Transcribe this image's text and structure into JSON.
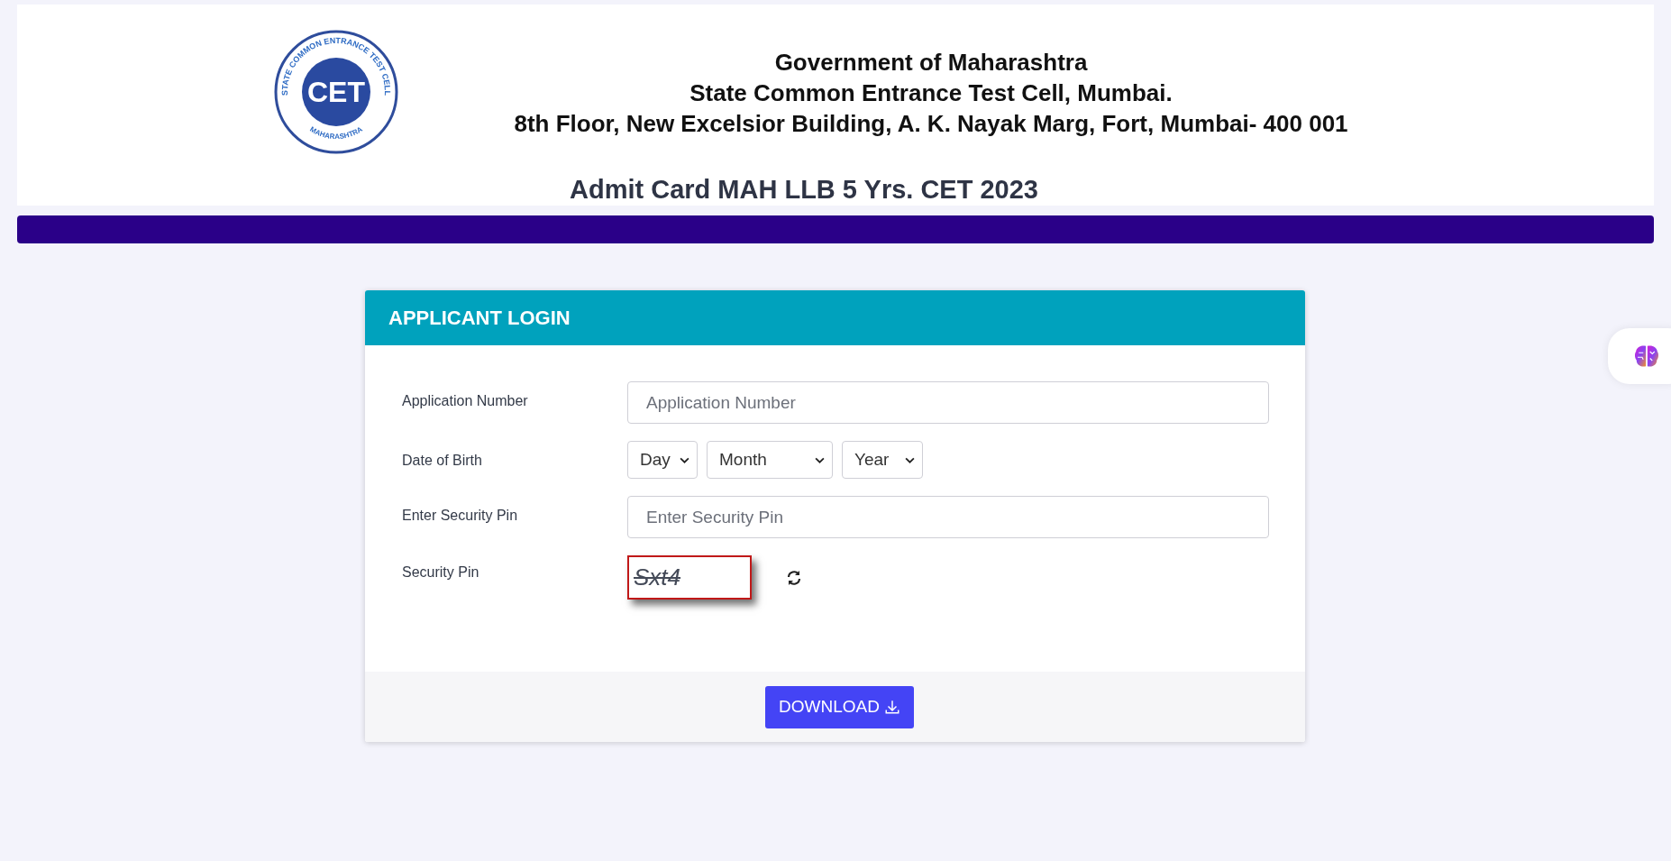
{
  "header": {
    "logo": {
      "ring_text": "STATE COMMON ENTRANCE TEST CELL",
      "center_text": "CET",
      "bottom_text": "MAHARASHTRA"
    },
    "lines": [
      "Government of Maharashtra",
      "State Common Entrance Test Cell, Mumbai.",
      "8th Floor, New Excelsior Building, A. K. Nayak Marg, Fort, Mumbai- 400 001"
    ],
    "title": "Admit Card MAH LLB 5 Yrs. CET 2023"
  },
  "login": {
    "title": "APPLICANT LOGIN",
    "rows": [
      {
        "kind": "input",
        "label": "Application Number",
        "placeholder": "Application Number"
      },
      {
        "kind": "selects",
        "label": "Date of Birth",
        "selects": [
          "Day",
          "Month",
          "Year"
        ]
      },
      {
        "kind": "input",
        "label": "Enter Security Pin",
        "placeholder": "Enter Security Pin"
      },
      {
        "kind": "captcha",
        "label": "Security Pin",
        "captcha": "Sxt4"
      }
    ],
    "button": "DOWNLOAD"
  }
}
